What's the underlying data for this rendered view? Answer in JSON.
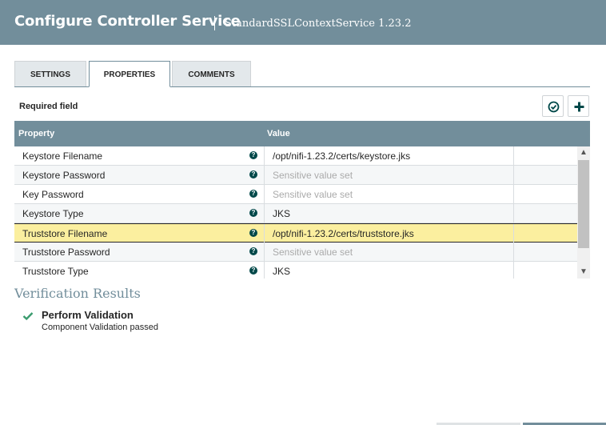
{
  "header": {
    "title": "Configure Controller Service",
    "subtitle": "StandardSSLContextService 1.23.2"
  },
  "tabs": [
    {
      "label": "SETTINGS",
      "active": false
    },
    {
      "label": "PROPERTIES",
      "active": true
    },
    {
      "label": "COMMENTS",
      "active": false
    }
  ],
  "required_field": "Required field",
  "toolbar": {
    "verify_icon": "check-circle-icon",
    "add_icon": "plus-icon"
  },
  "grid": {
    "columns": {
      "property": "Property",
      "value": "Value"
    },
    "help_glyph": "?",
    "rows": [
      {
        "name": "Keystore Filename",
        "value": "/opt/nifi-1.23.2/certs/keystore.jks",
        "sensitive": false
      },
      {
        "name": "Keystore Password",
        "value": "Sensitive value set",
        "sensitive": true
      },
      {
        "name": "Key Password",
        "value": "Sensitive value set",
        "sensitive": true
      },
      {
        "name": "Keystore Type",
        "value": "JKS",
        "sensitive": false
      },
      {
        "name": "Truststore Filename",
        "value": "/opt/nifi-1.23.2/certs/truststore.jks",
        "sensitive": false,
        "selected": true
      },
      {
        "name": "Truststore Password",
        "value": "Sensitive value set",
        "sensitive": true
      },
      {
        "name": "Truststore Type",
        "value": "JKS",
        "sensitive": false
      }
    ]
  },
  "verification": {
    "title": "Verification Results",
    "items": [
      {
        "name": "Perform Validation",
        "message": "Component Validation passed",
        "status": "success"
      }
    ]
  },
  "colors": {
    "header": "#728e9b",
    "selected_row": "#fbef9f",
    "success": "#3a9b6e",
    "help_icon": "#004849"
  }
}
